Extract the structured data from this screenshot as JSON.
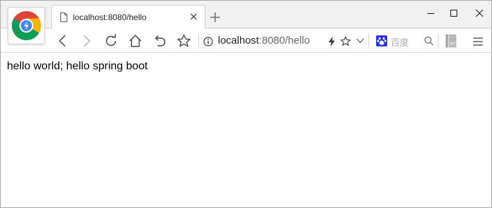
{
  "tab": {
    "title": "localhost:8080/hello"
  },
  "address_bar": {
    "host": "localhost",
    "rest": ":8080/hello"
  },
  "search": {
    "engine_label": "百度"
  },
  "extension": {
    "label": "RP"
  },
  "page": {
    "body_text": "hello world; hello spring boot"
  },
  "colors": {
    "chrome_red": "#DB4437",
    "chrome_yellow": "#F4B400",
    "chrome_green": "#0F9D58",
    "chrome_blue": "#4285F4",
    "baidu_blue": "#2932E1"
  }
}
